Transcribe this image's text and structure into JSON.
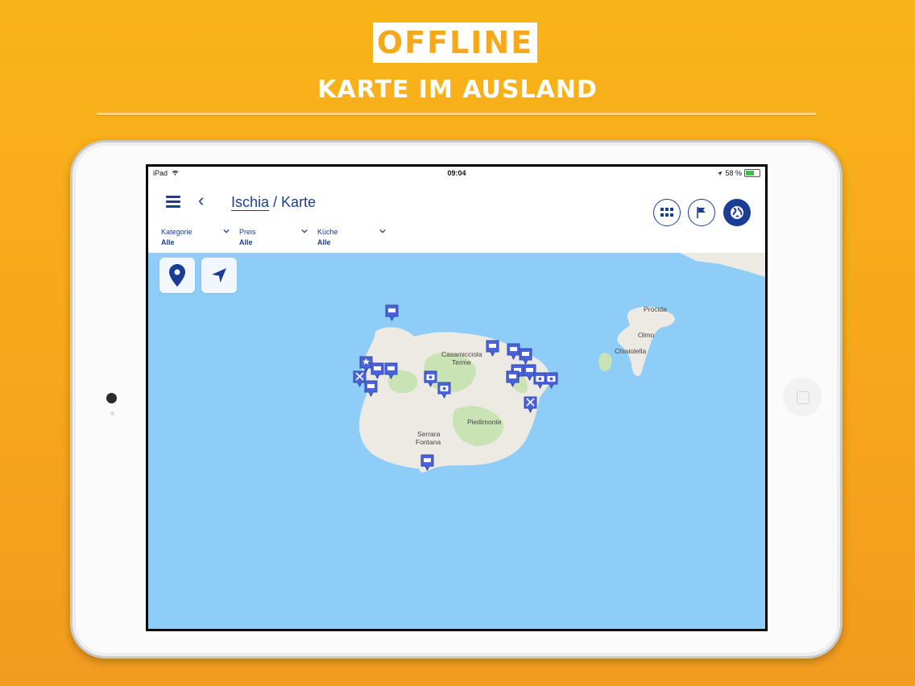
{
  "promo": {
    "badge": "OFFLINE",
    "subtitle": "KARTE IM AUSLAND"
  },
  "status_bar": {
    "device": "iPad",
    "time": "09:04",
    "battery": "58 %",
    "battery_level": 0.58
  },
  "header": {
    "breadcrumb_link": "Ischia",
    "separator": " / ",
    "title": "Karte"
  },
  "filters": [
    {
      "label": "Kategorie",
      "value": "Alle"
    },
    {
      "label": "Preis",
      "value": "Alle"
    },
    {
      "label": "Küche",
      "value": "Alle"
    }
  ],
  "toolbar": {
    "buttons": [
      "grid-icon",
      "flag-icon",
      "globe-icon"
    ]
  },
  "map_controls": [
    "location-pin-icon",
    "navigation-arrow-icon"
  ],
  "map_labels": {
    "procida": "Procida",
    "olmo": "Olmo",
    "chiaiolella": "Chiaiolella",
    "casamicciola": "Casamicciola",
    "terme": "Terme",
    "piedimonte": "Piedimonte",
    "serrara": "Serrara",
    "fontana": "Fontana"
  },
  "colors": {
    "background": "#f6a81b",
    "accent": "#1a3d96",
    "pin": "#4a63d6",
    "sea": "#8ecdf8",
    "land": "#eceae2",
    "green": "#c9e3b4"
  }
}
